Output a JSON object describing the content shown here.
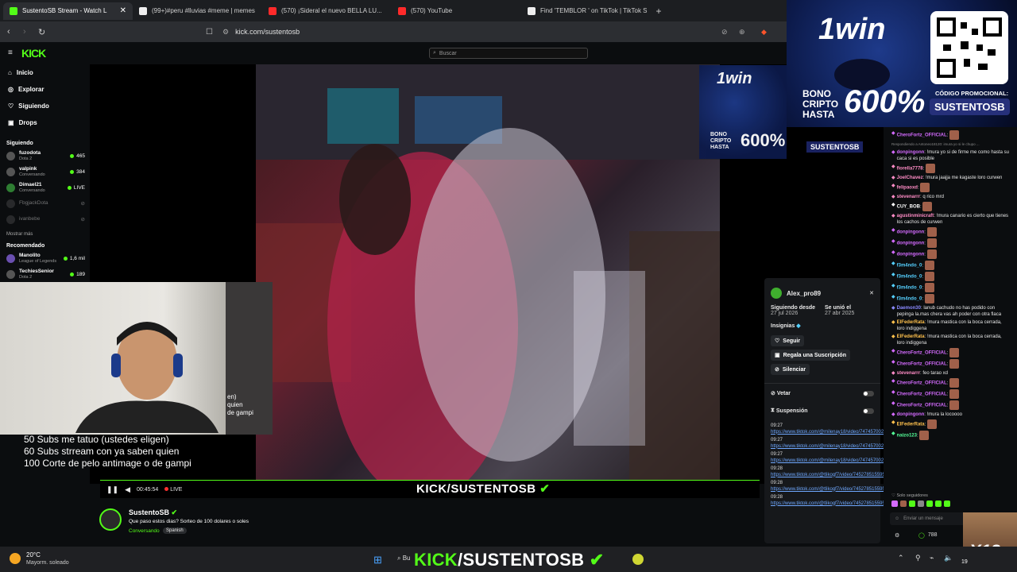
{
  "browser": {
    "tabs": [
      {
        "label": "SustentoSB Stream - Watch L",
        "active": true,
        "color": "#53fc18"
      },
      {
        "label": "(99+)#peru #lluvias #meme | memes",
        "active": false,
        "color": "#eeeeee"
      },
      {
        "label": "(570) ¡Sideral el nuevo BELLA LU...",
        "active": false,
        "color": "#ff2a2a"
      },
      {
        "label": "(570) YouTube",
        "active": false,
        "color": "#ff2a2a"
      },
      {
        "label": "Find 'TEMBLOR ' on TikTok | TikTok S",
        "active": false,
        "color": "#eeeeee"
      }
    ],
    "url": "kick.com/sustentosb",
    "new_tab": "+"
  },
  "kick": {
    "logo": "KICK",
    "search_placeholder": "Buscar",
    "nav": [
      {
        "label": "Inicio",
        "icon": "home-icon"
      },
      {
        "label": "Explorar",
        "icon": "compass-icon"
      },
      {
        "label": "Siguiendo",
        "icon": "heart-icon"
      },
      {
        "label": "Drops",
        "icon": "gift-icon"
      }
    ],
    "following_title": "Siguiendo",
    "following": [
      {
        "name": "fuzodota",
        "sub": "Dota 2",
        "count": "465",
        "live": false
      },
      {
        "name": "valpink",
        "sub": "Conversando",
        "count": "384",
        "live": false
      },
      {
        "name": "Dimael21",
        "sub": "Conversando",
        "count": "LIVE",
        "live": true
      },
      {
        "name": "FbgjackDota",
        "sub": "",
        "count": "",
        "live": false,
        "offline": true
      },
      {
        "name": "ivanbebe",
        "sub": "",
        "count": "",
        "live": false,
        "offline": true
      }
    ],
    "show_more": "Mostrar más",
    "recommended_title": "Recomendado",
    "recommended": [
      {
        "name": "Manolito",
        "sub": "League of Legends",
        "count": "1,6 mil"
      },
      {
        "name": "TechiesSenior",
        "sub": "Dota 2",
        "count": "189"
      }
    ]
  },
  "stream": {
    "overlay_lines": [
      "50 Subs me tatuo (ustedes eligen)",
      "60 Subs strream con ya saben quien",
      "100 Corte de pelo antimage o de gampi"
    ],
    "time": "00:45:54",
    "live_label": "LIVE",
    "banner": "KICK/SUSTENTOSB",
    "cam_text": "en)\nquien\nde gampi",
    "streamer": "SustentoSB",
    "title": "Que paso estos dias? Sorteo de 100 dolares o soles",
    "category": "Conversando",
    "language": "Spanish"
  },
  "ad": {
    "brand": "1win",
    "bono": "BONO",
    "cripto": "CRIPTO",
    "hasta": "HASTA",
    "percent": "600%",
    "code_label": "CÓDIGO PROMOCIONAL:",
    "code": "SUSTENTOSB"
  },
  "user_card": {
    "name": "Alex_pro89",
    "follow_label": "Siguiendo desde",
    "follow_date": "27 jul 2026",
    "joined_label": "Se unió el",
    "joined_date": "27 abr 2025",
    "badges_label": "Insignias",
    "follow_btn": "Seguir",
    "gift_btn": "Regala una Suscripción",
    "mute_btn": "Silenciar",
    "ban_label": "Vetar",
    "timeout_label": "Suspensión",
    "logs": [
      {
        "t": "09:27",
        "link": "https://www.tiktok.com/@milenay18/video/7474570029337283861"
      },
      {
        "t": "09:27",
        "link": "https://www.tiktok.com/@milenay18/video/7474570029337283861"
      },
      {
        "t": "09:27",
        "link": "https://www.tiktok.com/@milenay18/video/7474570029337283861"
      },
      {
        "t": "09:28",
        "link": "https://www.tiktok.com/@tlikogf7/video/7452785155958244044"
      },
      {
        "t": "09:28",
        "link": "https://www.tiktok.com/@tlikogf7/video/7452785155958244044"
      },
      {
        "t": "09:28",
        "link": "https://www.tiktok.com/@tlikogf7/video/7452785155958244044"
      }
    ]
  },
  "chat": {
    "messages": [
      {
        "user": "CheroFortz_OFFICIAL",
        "color": "#d46bff",
        "text": "",
        "emote": true
      },
      {
        "user": "",
        "color": "#888888",
        "text": "Respondiendo a Antoneo18120: imura yo si le chupo ...",
        "emote": false,
        "reply": true
      },
      {
        "user": "donpingonn",
        "color": "#d46bff",
        "text": "!mura yo si de firme me como hasta su caca si es posible",
        "emote": false
      },
      {
        "user": "fiorella7778",
        "color": "#ff8cc6",
        "text": "",
        "emote": true
      },
      {
        "user": "JoelChavez",
        "color": "#ff8cc6",
        "text": "!mura jaajja me kagaste loro curwen",
        "emote": false
      },
      {
        "user": "felipaoxd",
        "color": "#ff8cc6",
        "text": "",
        "emote": true
      },
      {
        "user": "stevenarrr",
        "color": "#ff8cc6",
        "text": "q rico mrd",
        "emote": false
      },
      {
        "user": "CUY_BOB",
        "color": "#ffffff",
        "text": "",
        "emote": true
      },
      {
        "user": "agustinminicraft",
        "color": "#ff8cc6",
        "text": "!mura canario es cierto que tienes los cachos de curwen",
        "emote": false
      },
      {
        "user": "donpingonn",
        "color": "#d46bff",
        "text": "",
        "emote": true
      },
      {
        "user": "donpingonn",
        "color": "#d46bff",
        "text": "",
        "emote": true
      },
      {
        "user": "donpingonn",
        "color": "#d46bff",
        "text": "",
        "emote": true
      },
      {
        "user": "f3m4ndo_0",
        "color": "#55d0ff",
        "text": "",
        "emote": true
      },
      {
        "user": "f3m4ndo_0",
        "color": "#55d0ff",
        "text": "",
        "emote": true
      },
      {
        "user": "f3m4ndo_0",
        "color": "#55d0ff",
        "text": "",
        "emote": true
      },
      {
        "user": "f3m4ndo_0",
        "color": "#55d0ff",
        "text": "",
        "emote": true
      },
      {
        "user": "Daemon30",
        "color": "#8a8aff",
        "text": "lanub cachudo no has podido con pepinga la.mas chera vas ah poder con otra flaca",
        "emote": false
      },
      {
        "user": "ElFederRata",
        "color": "#ffc14d",
        "text": "!mura mastica con la boca cerrada, loro indiggena",
        "emote": false
      },
      {
        "user": "ElFederRata",
        "color": "#ffc14d",
        "text": "!mura mastica con la boca cerrada, loro indiggena",
        "emote": false
      },
      {
        "user": "CheroFortz_OFFICIAL",
        "color": "#d46bff",
        "text": "",
        "emote": true
      },
      {
        "user": "CheroFortz_OFFICIAL",
        "color": "#d46bff",
        "text": "",
        "emote": true
      },
      {
        "user": "stevenarrr",
        "color": "#ff8cc6",
        "text": "feo tarao xd",
        "emote": false
      },
      {
        "user": "CheroFortz_OFFICIAL",
        "color": "#d46bff",
        "text": "",
        "emote": true
      },
      {
        "user": "CheroFortz_OFFICIAL",
        "color": "#d46bff",
        "text": "",
        "emote": true
      },
      {
        "user": "CheroFortz_OFFICIAL",
        "color": "#d46bff",
        "text": "",
        "emote": true
      },
      {
        "user": "donpingonn",
        "color": "#d46bff",
        "text": "!mura la locoooo",
        "emote": false
      },
      {
        "user": "ElFederRata",
        "color": "#ffc14d",
        "text": "",
        "emote": true
      },
      {
        "user": "naizo123",
        "color": "#55ff99",
        "text": "",
        "emote": true
      }
    ],
    "followers_only": "Solo seguidores",
    "input_placeholder": "Enviar un mensaje",
    "points": "788",
    "multiplier": "X13"
  },
  "taskbar": {
    "temp": "20°C",
    "weather": "Mayorm. soleado",
    "search": "Bu",
    "clock": "19"
  }
}
